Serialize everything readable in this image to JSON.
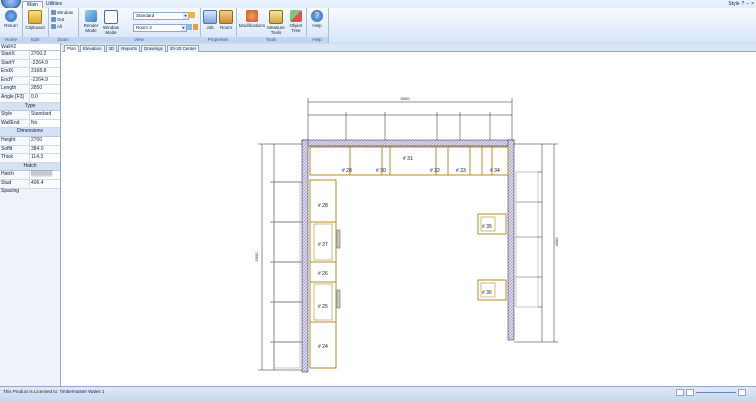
{
  "ribbon": {
    "tabs": [
      "Main",
      "Utilities"
    ],
    "window_controls": [
      "Style",
      "?",
      "–",
      "×"
    ],
    "groups": {
      "home": {
        "label": "Home",
        "return_label": "Return"
      },
      "edit": {
        "label": "Edit",
        "clipboard_label": "Clipboard"
      },
      "zoom": {
        "label": "Zoom",
        "window_label": "Window",
        "out_label": "Out",
        "all_label": "All"
      },
      "view": {
        "label": "View",
        "render_mode_label": "Render Mode",
        "window_mode_label": "Window Mode",
        "style_value": "Standard",
        "room_value": "Room 3"
      },
      "properties": {
        "label": "Properties",
        "job_label": "Job",
        "room_label": "Room"
      },
      "tools": {
        "label": "Tools",
        "modifications_label": "Modifications",
        "measure_tools_label": "Measure Tools",
        "object_tree_label": "Object Tree"
      },
      "help": {
        "label": "Help",
        "help_label": "Help"
      }
    }
  },
  "props": {
    "title": "Wall#2",
    "rows1": [
      {
        "k": "StartX",
        "v": "2700.2"
      },
      {
        "k": "StartY",
        "v": "-2264.9"
      },
      {
        "k": "EndX",
        "v": "3168.8"
      },
      {
        "k": "EndY",
        "v": "-2264.9"
      },
      {
        "k": "Length",
        "v": "2850"
      },
      {
        "k": "Angle [F3]",
        "v": "0.0"
      }
    ],
    "sec_type": "Type",
    "rows2": [
      {
        "k": "Style",
        "v": "Standard"
      },
      {
        "k": "WallEnd",
        "v": "No"
      }
    ],
    "sec_dims": "Dimensions",
    "rows3": [
      {
        "k": "Height",
        "v": "2700"
      },
      {
        "k": "Soffit",
        "v": "384.0"
      },
      {
        "k": "Thick",
        "v": "114.3"
      }
    ],
    "sec_hatch": "Hatch",
    "rows4": [
      {
        "k": "Hatch",
        "v": "▒▒▒▒▒▒"
      },
      {
        "k": "Stud Spacing",
        "v": "406.4"
      }
    ]
  },
  "doc_tabs": [
    "Plan",
    "Elevation",
    "3D",
    "Reports",
    "Drawings",
    "20-20 Center"
  ],
  "plan": {
    "cabinets": [
      "# 28",
      "# 30",
      "# 31",
      "# 32",
      "# 33",
      "# 34",
      "# 28",
      "# 27",
      "# 26",
      "# 25",
      "# 24",
      "# 35",
      "# 36"
    ],
    "dim_top": "5000",
    "dim_left": "5000",
    "dim_right": "4000"
  },
  "status": {
    "text": "This Product is Licensed to: Timbermaster Wales 1"
  }
}
